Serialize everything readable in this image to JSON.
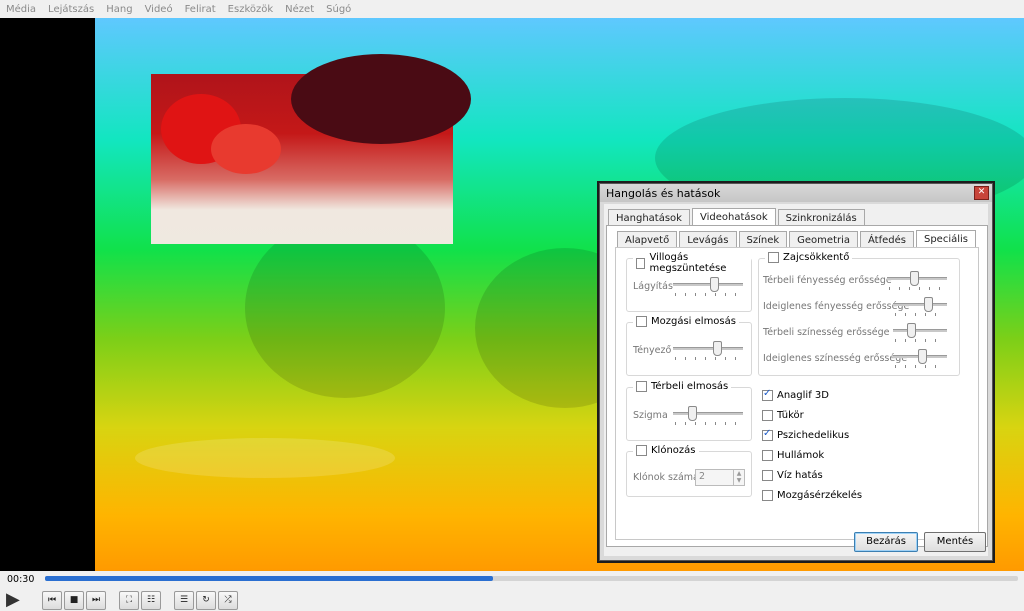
{
  "menu": [
    "Média",
    "Lejátszás",
    "Hang",
    "Videó",
    "Felirat",
    "Eszközök",
    "Nézet",
    "Súgó"
  ],
  "dialog": {
    "title": "Hangolás és hatások",
    "main_tabs": [
      "Hanghatások",
      "Videohatások",
      "Szinkronizálás"
    ],
    "active_main_tab": "Videohatások",
    "sub_tabs": [
      "Alapvető",
      "Levágás",
      "Színek",
      "Geometria",
      "Átfedés",
      "Speciális"
    ],
    "active_sub_tab": "Speciális",
    "groups": {
      "flicker": {
        "label": "Villogás megszüntetése",
        "checked": false,
        "param_label": "Lágyítás",
        "level": 0.6
      },
      "motion_blur": {
        "label": "Mozgási elmosás",
        "checked": false,
        "param_label": "Tényező",
        "level": 0.65
      },
      "spatial_blur": {
        "label": "Térbeli elmosás",
        "checked": false,
        "param_label": "Szigma",
        "level": 0.25
      },
      "clone": {
        "label": "Klónozás",
        "checked": false,
        "param_label": "Klónok száma",
        "value": "2"
      },
      "denoise": {
        "label": "Zajcsökkentő",
        "checked": false,
        "params": [
          {
            "label": "Térbeli fényesség erőssége",
            "level": 0.45
          },
          {
            "label": "Ideiglenes fényesség erőssége",
            "level": 0.7
          },
          {
            "label": "Térbeli színesség erőssége",
            "level": 0.3
          },
          {
            "label": "Ideiglenes színesség erőssége",
            "level": 0.55
          }
        ]
      }
    },
    "checks": [
      {
        "label": "Anaglif 3D",
        "checked": true
      },
      {
        "label": "Tükör",
        "checked": false
      },
      {
        "label": "Pszichedelikus",
        "checked": true
      },
      {
        "label": "Hullámok",
        "checked": false
      },
      {
        "label": "Víz hatás",
        "checked": false
      },
      {
        "label": "Mozgásérzékelés",
        "checked": false
      }
    ],
    "buttons": {
      "close": "Bezárás",
      "save": "Mentés"
    }
  },
  "player": {
    "time": "00:30",
    "progress": 0.46,
    "controls": [
      "play-icon",
      "previous-icon",
      "stop-icon",
      "next-icon",
      "fullscreen-icon",
      "equalizer-icon",
      "playlist-icon",
      "loop-icon",
      "shuffle-icon"
    ]
  }
}
